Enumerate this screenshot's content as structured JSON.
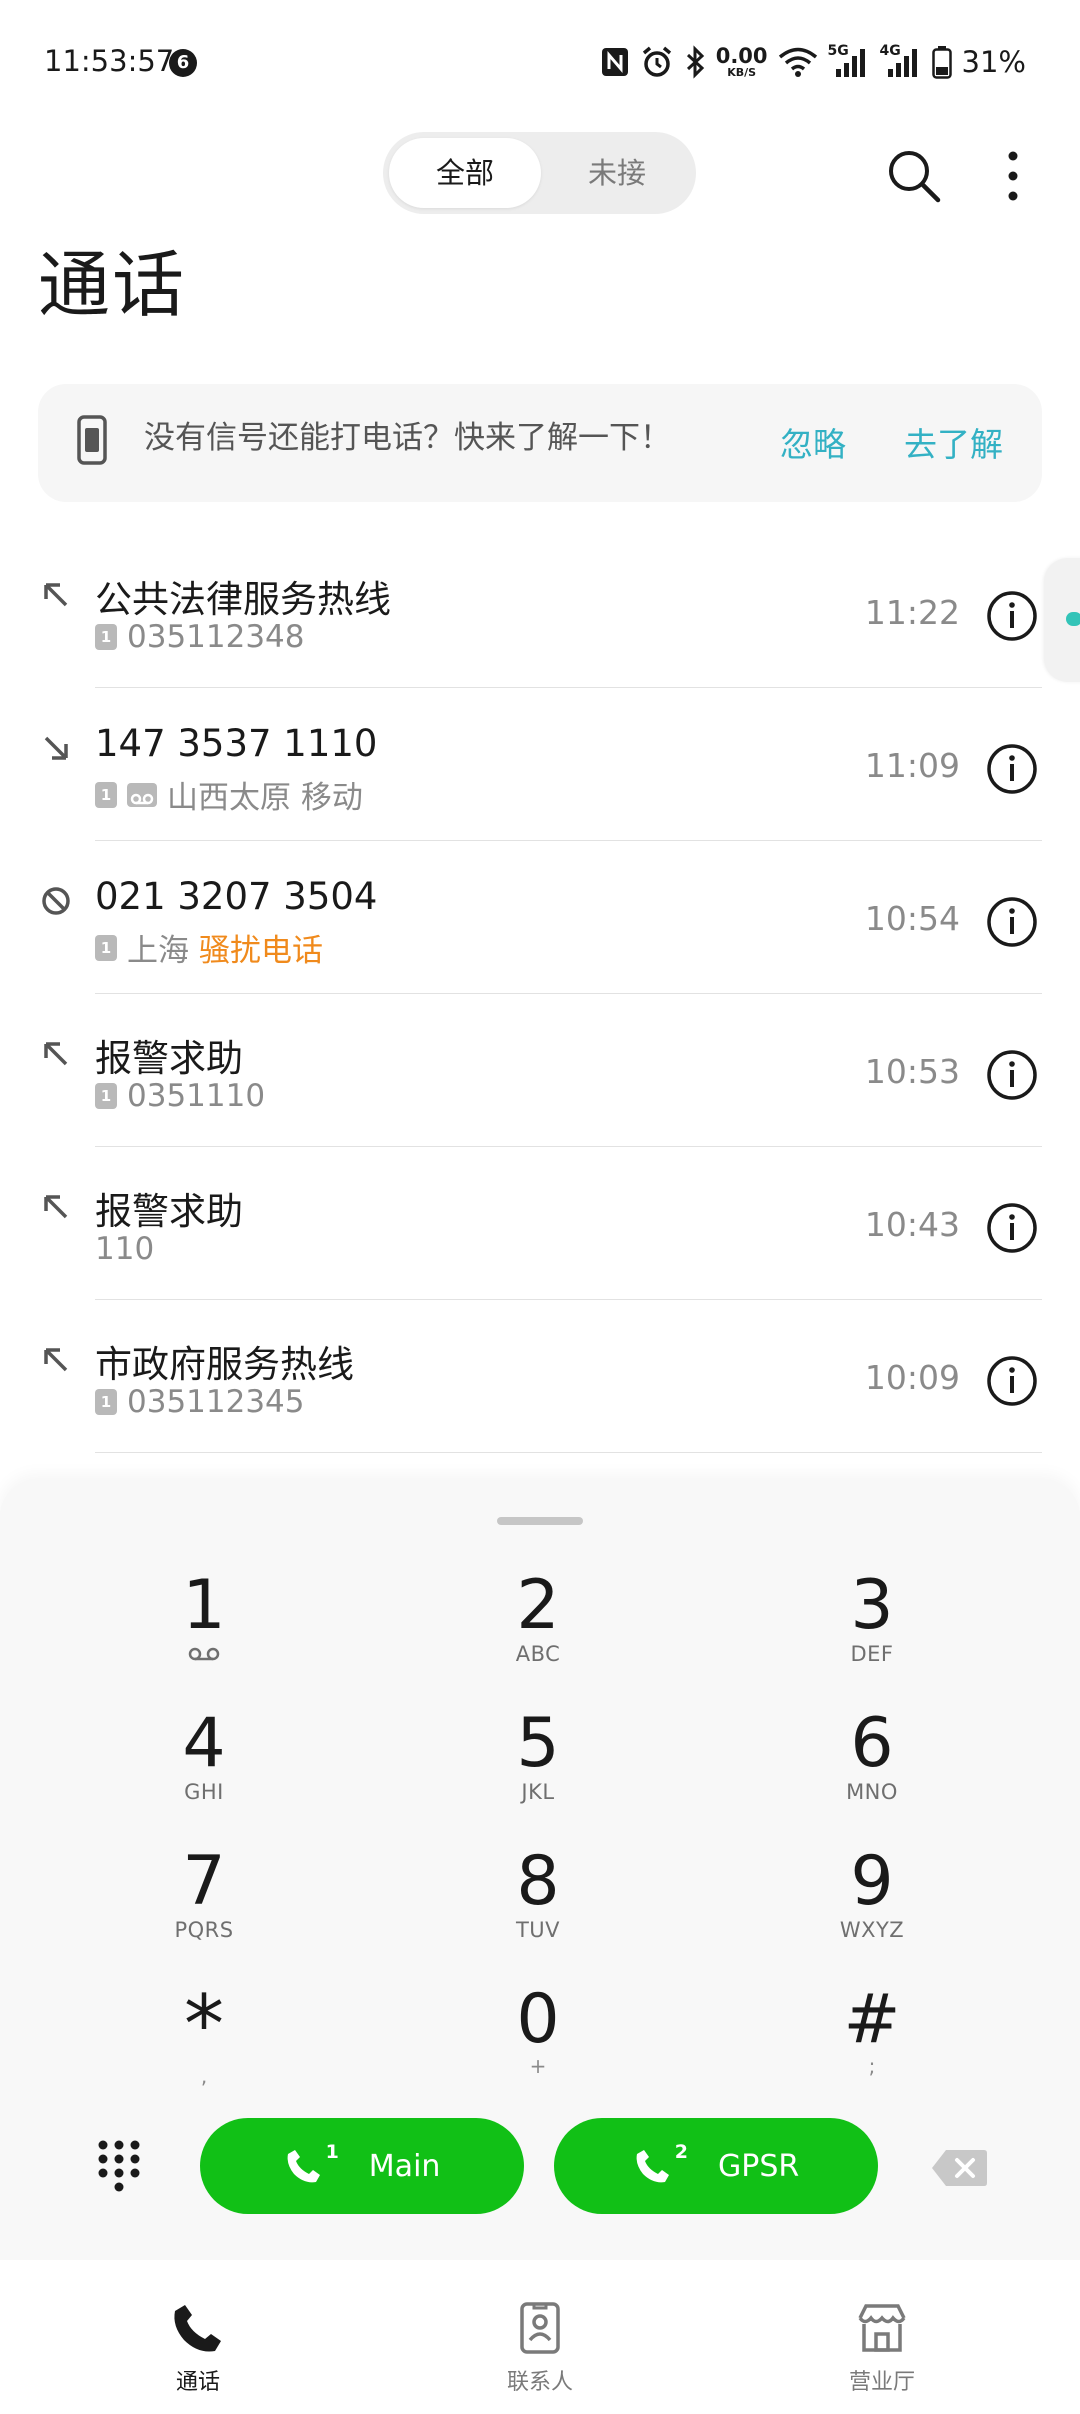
{
  "status_bar": {
    "time": "11:53:57",
    "notification_count": "6",
    "net_speed_value": "0.00",
    "net_speed_unit": "KB/S",
    "signal_1": "5G",
    "signal_2": "4G",
    "battery": "31%"
  },
  "header": {
    "filter_all": "全部",
    "filter_missed": "未接",
    "title": "通话"
  },
  "banner": {
    "text": "没有信号还能打电话？快来了解一下！",
    "ignore": "忽略",
    "learn_more": "去了解"
  },
  "calls": [
    {
      "name": "公共法律服务热线",
      "sim": "1",
      "detail": "035112348",
      "time": "11:22",
      "type": "outgoing"
    },
    {
      "name": "147 3537 1110",
      "sim": "1",
      "detail": "山西太原 移动",
      "time": "11:09",
      "type": "incoming"
    },
    {
      "name": "021 3207 3504",
      "sim": "1",
      "detail": "上海",
      "tag": "骚扰电话",
      "time": "10:54",
      "type": "blocked"
    },
    {
      "name": "报警求助",
      "sim": "1",
      "detail": "0351110",
      "time": "10:53",
      "type": "outgoing"
    },
    {
      "name": "报警求助",
      "detail": "110",
      "time": "10:43",
      "type": "outgoing"
    },
    {
      "name": "市政府服务热线",
      "sim": "1",
      "detail": "035112345",
      "time": "10:09",
      "type": "outgoing"
    }
  ],
  "dialpad": {
    "keys": [
      {
        "digit": "1",
        "letters": ""
      },
      {
        "digit": "2",
        "letters": "ABC"
      },
      {
        "digit": "3",
        "letters": "DEF"
      },
      {
        "digit": "4",
        "letters": "GHI"
      },
      {
        "digit": "5",
        "letters": "JKL"
      },
      {
        "digit": "6",
        "letters": "MNO"
      },
      {
        "digit": "7",
        "letters": "PQRS"
      },
      {
        "digit": "8",
        "letters": "TUV"
      },
      {
        "digit": "9",
        "letters": "WXYZ"
      },
      {
        "digit": "*",
        "letters": ","
      },
      {
        "digit": "0",
        "letters": "+"
      },
      {
        "digit": "#",
        "letters": ";"
      }
    ],
    "call_main_sim": "1",
    "call_main_label": "Main",
    "call_gpsr_sim": "2",
    "call_gpsr_label": "GPSR"
  },
  "bottom_nav": {
    "calls": "通话",
    "contacts": "联系人",
    "store": "营业厅"
  },
  "colors": {
    "accent_teal": "#33b1c4",
    "call_green": "#11c016",
    "spam_orange": "#f08a1c"
  }
}
